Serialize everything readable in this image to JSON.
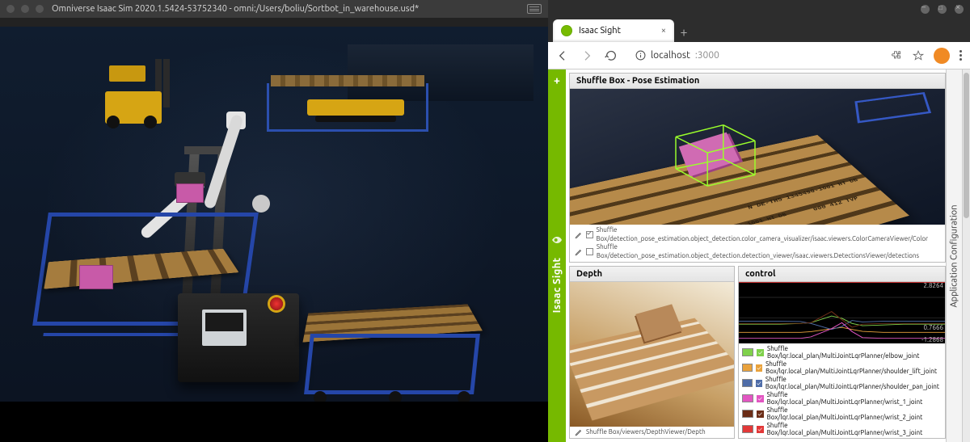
{
  "left_window": {
    "title": "Omniverse Isaac Sim 2020.1.5424-53752340 - omni:/Users/boliu/Sortbot_in_warehouse.usd*"
  },
  "browser": {
    "tab_title": "Isaac Sight",
    "url_host": "localhost",
    "url_port": ":3000"
  },
  "sight": {
    "sidebar_label": "Isaac Sight",
    "add_tooltip": "+",
    "right_sidebar_label": "Application Configuration"
  },
  "pose_panel": {
    "title": "Shuffle Box - Pose Estimation",
    "pallet_stamps": {
      "s1": "N DE-TH5\n1345490-1001\nHT DB",
      "s2": "000 412\nTVP",
      "s3": "N DE-TH5\n1345490-1001\nHT DB"
    },
    "footer": [
      {
        "checked": true,
        "path": "Shuffle Box/detection_pose_estimation.object_detection.color_camera_visualizer/isaac.viewers.ColorCameraViewer/Color"
      },
      {
        "checked": false,
        "path": "Shuffle Box/detection_pose_estimation.object_detection.detection_viewer/isaac.viewers.DetectionsViewer/detections"
      }
    ]
  },
  "depth_panel": {
    "title": "Depth",
    "footer_path": "Shuffle Box/viewers/DepthViewer/Depth"
  },
  "control_panel": {
    "title": "control",
    "yticks": {
      "top": "2.8264",
      "mid": "0.7666",
      "bot": "-1.2868"
    },
    "legend": [
      {
        "color": "#7fd14b",
        "checked": true,
        "label": "Shuffle Box/lqr.local_plan/MultiJointLqrPlanner/elbow_joint"
      },
      {
        "color": "#e9a23c",
        "checked": true,
        "label": "Shuffle Box/lqr.local_plan/MultiJointLqrPlanner/shoulder_lift_joint"
      },
      {
        "color": "#4f6da8",
        "checked": true,
        "label": "Shuffle Box/lqr.local_plan/MultiJointLqrPlanner/shoulder_pan_joint"
      },
      {
        "color": "#e256c2",
        "checked": true,
        "label": "Shuffle Box/lqr.local_plan/MultiJointLqrPlanner/wrist_1_joint"
      },
      {
        "color": "#6b2d17",
        "checked": true,
        "label": "Shuffle Box/lqr.local_plan/MultiJointLqrPlanner/wrist_2_joint"
      },
      {
        "color": "#e23838",
        "checked": true,
        "label": "Shuffle Box/lqr.local_plan/MultiJointLqrPlanner/wrist_3_joint"
      }
    ]
  },
  "chart_data": {
    "type": "line",
    "title": "control",
    "ylabel": "",
    "ylim": [
      -1.29,
      2.83
    ],
    "x": [
      0,
      0.1,
      0.2,
      0.3,
      0.35,
      0.45,
      0.5,
      0.55,
      0.6,
      0.7,
      0.8,
      0.9,
      1.0
    ],
    "series": [
      {
        "name": "elbow_joint",
        "color": "#7fd14b",
        "values": [
          0.0,
          0.0,
          0.0,
          0.05,
          0.1,
          0.55,
          0.4,
          0.05,
          -0.1,
          -0.05,
          0.0,
          0.0,
          0.0
        ]
      },
      {
        "name": "shoulder_lift_joint",
        "color": "#e9a23c",
        "values": [
          -0.55,
          -0.55,
          -0.55,
          -0.55,
          -0.5,
          -0.3,
          -0.22,
          -0.35,
          -0.48,
          -0.55,
          -0.55,
          -0.55,
          -0.55
        ]
      },
      {
        "name": "shoulder_pan_joint",
        "color": "#4f6da8",
        "values": [
          0.2,
          0.2,
          0.2,
          0.18,
          0.05,
          -0.35,
          -0.15,
          0.25,
          0.15,
          0.2,
          0.2,
          0.2,
          0.2
        ]
      },
      {
        "name": "wrist_1_joint",
        "color": "#e256c2",
        "values": [
          -0.95,
          -0.95,
          -0.95,
          -0.95,
          -0.85,
          -0.3,
          0.1,
          -0.5,
          -0.9,
          -0.95,
          -0.95,
          -0.95,
          -0.95
        ]
      },
      {
        "name": "wrist_2_joint",
        "color": "#6b2d17",
        "values": [
          0.05,
          0.05,
          0.05,
          0.05,
          0.1,
          0.85,
          0.3,
          -0.2,
          0.0,
          0.05,
          0.05,
          0.05,
          0.05
        ]
      },
      {
        "name": "wrist_3_joint",
        "color": "#e23838",
        "values": [
          2.8,
          2.8,
          2.8,
          2.8,
          2.8,
          2.8,
          2.8,
          2.8,
          2.8,
          2.8,
          2.8,
          2.8,
          2.8
        ]
      }
    ]
  }
}
